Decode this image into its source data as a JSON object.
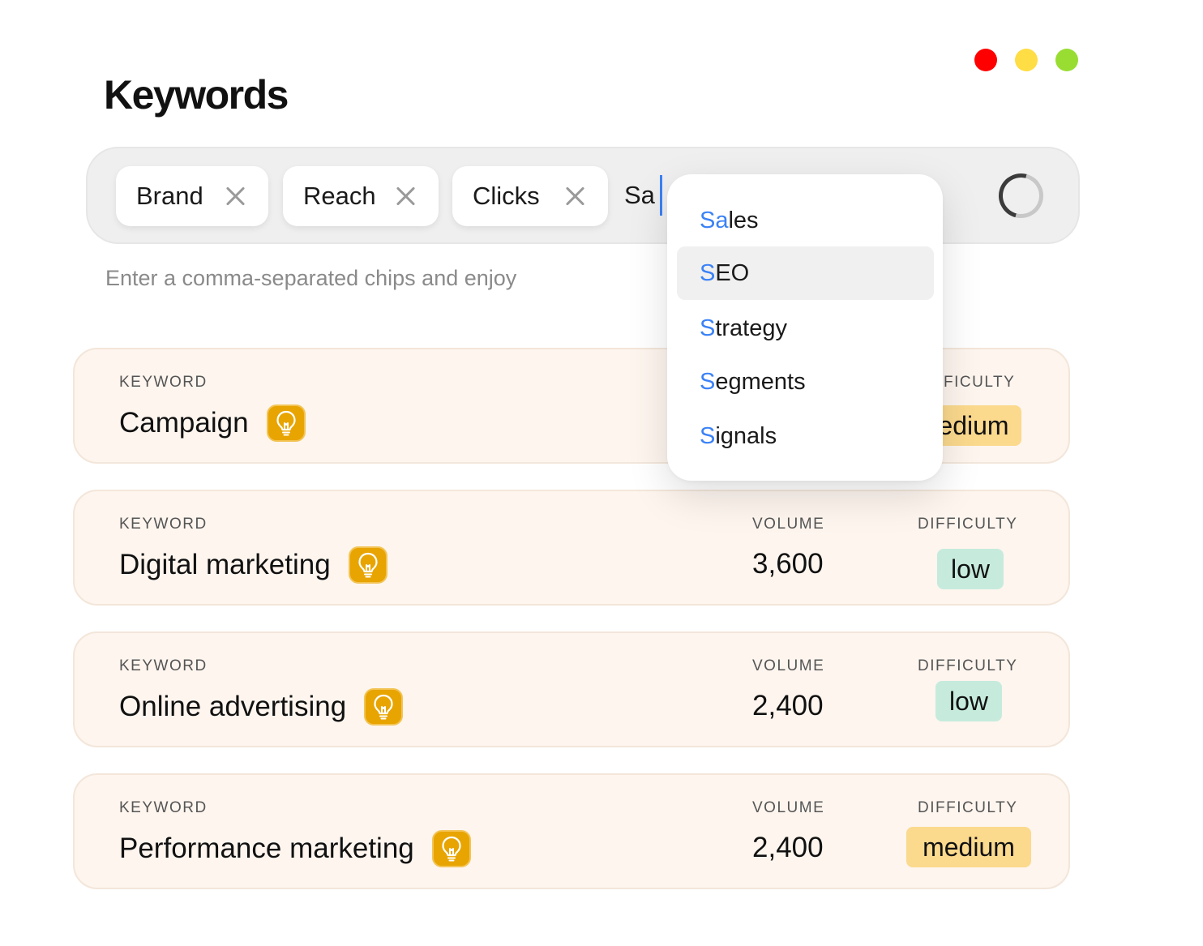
{
  "window": {
    "controls": [
      "close",
      "minimize",
      "maximize"
    ]
  },
  "page": {
    "title": "Keywords"
  },
  "chip_input": {
    "chips": [
      {
        "label": "Brand"
      },
      {
        "label": "Reach"
      },
      {
        "label": "Clicks"
      }
    ],
    "typed_value": "Sa",
    "loading": true,
    "hint": "Enter a comma-separated chips and enjoy"
  },
  "suggestions": {
    "items": [
      {
        "match": "Sa",
        "rest": "les",
        "active": false
      },
      {
        "match": "S",
        "rest": "EO",
        "active": true
      },
      {
        "match": "S",
        "rest": "trategy",
        "active": false
      },
      {
        "match": "S",
        "rest": "egments",
        "active": false
      },
      {
        "match": "S",
        "rest": "ignals",
        "active": false
      }
    ]
  },
  "table": {
    "labels": {
      "keyword": "KEYWORD",
      "volume": "VOLUME",
      "difficulty": "DIFFICULTY",
      "difficulty_partial": "FICULTY"
    },
    "rows": [
      {
        "keyword": "Campaign",
        "volume": "",
        "difficulty": "medium",
        "difficulty_visible": "edium"
      },
      {
        "keyword": "Digital marketing",
        "volume": "3,600",
        "difficulty": "low"
      },
      {
        "keyword": "Online advertising",
        "volume": "2,400",
        "difficulty": "low"
      },
      {
        "keyword": "Performance marketing",
        "volume": "2,400",
        "difficulty": "medium"
      }
    ]
  },
  "colors": {
    "accent": "#3b82f6",
    "bulb": "#e8a400",
    "medium": "#fbd98d",
    "low": "#c6ebdd",
    "card": "#fdf5ee"
  },
  "icons": {
    "chip_remove": "close-icon",
    "bulb": "lightbulb-icon",
    "loader": "spinner-icon"
  }
}
